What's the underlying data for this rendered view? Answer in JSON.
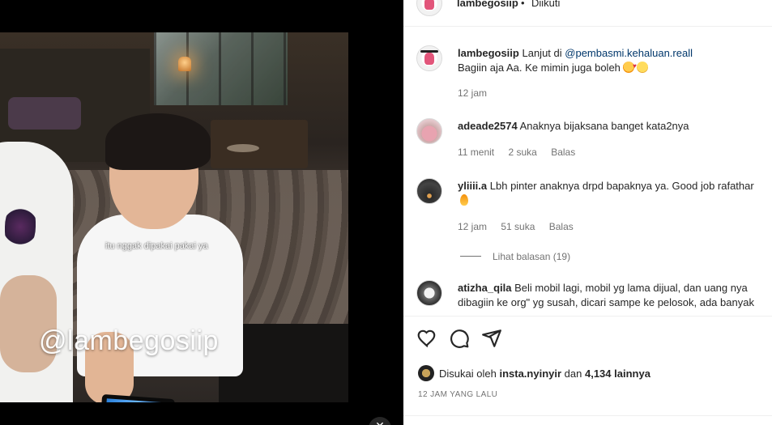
{
  "video": {
    "subtitle": "itu nggak dipakai pakai ya",
    "watermark": "@lambegosiip"
  },
  "header": {
    "username": "lambegosiip",
    "separator": "•",
    "follow_status": "Diikuti"
  },
  "comments": [
    {
      "username": "lambegosiip",
      "text_prefix": "Lanjut di",
      "mention": "@pembasmi.kehaluan.reall",
      "line2": "Bagiin aja Aa. Ke mimin juga boleh",
      "time": "12 jam"
    },
    {
      "username": "adeade2574",
      "text": "Anaknya bijaksana banget kata2nya",
      "time": "11 menit",
      "likes": "2 suka",
      "reply": "Balas"
    },
    {
      "username": "yliiii.a",
      "text": "Lbh pinter anaknya drpd bapaknya ya. Good job rafathar",
      "time": "12 jam",
      "likes": "51 suka",
      "reply": "Balas",
      "view_replies": "Lihat balasan (19)"
    },
    {
      "username": "atizha_qila",
      "text": "Beli mobil lagi, mobil yg lama dijual, dan uang nya",
      "line2": "dibagiin ke org\" yg susah, dicari sampe ke pelosok, ada banyak"
    }
  ],
  "actions": {
    "icons": [
      "heart-icon",
      "comment-icon",
      "share-icon"
    ],
    "liked_prefix": "Disukai oleh",
    "liked_user": "insta.nyinyir",
    "liked_mid": "dan",
    "liked_count": "4,134 lainnya",
    "time_ago": "12 JAM YANG LALU"
  }
}
